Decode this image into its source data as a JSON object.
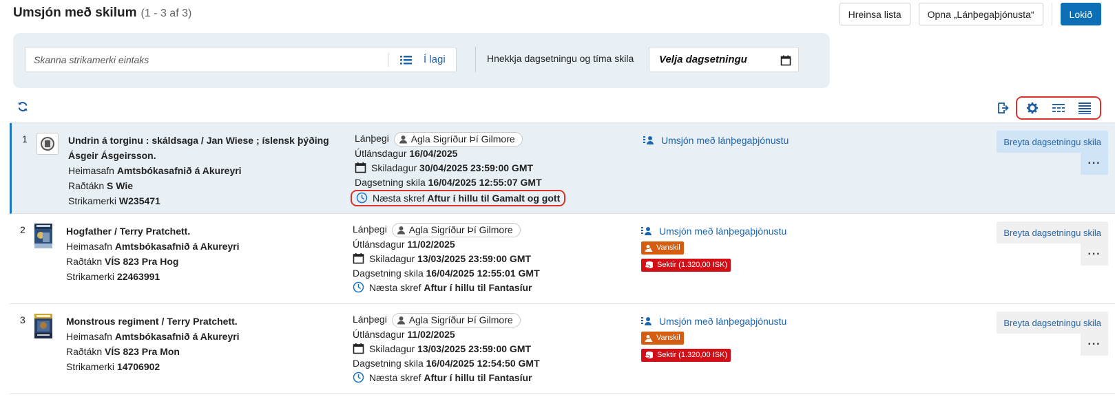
{
  "header": {
    "title": "Umsjón með skilum",
    "count": "(1 - 3 af 3)",
    "buttons": {
      "clear": "Hreinsa lista",
      "open_services": "Opna „Lánþegaþjónusta“",
      "done": "Lokið"
    }
  },
  "scan": {
    "placeholder": "Skanna strikamerki eintaks",
    "ok_label": "Í lagi",
    "date_label": "Hnekkja dagsetningu og tíma skila",
    "date_placeholder": "Velja dagsetningu"
  },
  "icons": {
    "refresh": "refresh-icon",
    "export": "export-icon",
    "settings": "gear-icon",
    "compact_view": "list-compact-icon",
    "full_view": "list-full-icon"
  },
  "colors": {
    "accent": "#0c6fb6",
    "link": "#1a64b0",
    "late_badge": "#d45d0f",
    "fine_badge": "#d20f16",
    "highlight": "#d9342b"
  },
  "rows": [
    {
      "num": "1",
      "title": "Undrin á torginu : skáldsaga / Jan Wiese ; íslensk þýðing Ásgeir Ásgeirsson.",
      "home_label": "Heimasafn",
      "home": "Amtsbókasafnið á Akureyri",
      "call_label": "Raðtákn",
      "call": "S Wie",
      "barcode_label": "Strikamerki",
      "barcode": "W235471",
      "patron_label": "Lánþegi",
      "patron": "Agla Sigríður Þí Gilmore",
      "loan_label": "Útlánsdagur",
      "loan_date": "16/04/2025",
      "due_label": "Skiladagur",
      "due_date": "30/04/2025 23:59:00 GMT",
      "return_label": "Dagsetning skila",
      "return_date": "16/04/2025 12:55:07 GMT",
      "next_label": "Næsta skref",
      "next_step": "Aftur í hillu til Gamalt og gott",
      "service_link": "Umsjón með lánþegaþjónustu",
      "late": "",
      "fine": "",
      "change_label": "Breyta dagsetningu skila",
      "more": "···"
    },
    {
      "num": "2",
      "title": "Hogfather / Terry Pratchett.",
      "home_label": "Heimasafn",
      "home": "Amtsbókasafnið á Akureyri",
      "call_label": "Raðtákn",
      "call": "VÍS 823 Pra Hog",
      "barcode_label": "Strikamerki",
      "barcode": "22463991",
      "patron_label": "Lánþegi",
      "patron": "Agla Sigríður Þí Gilmore",
      "loan_label": "Útlánsdagur",
      "loan_date": "11/02/2025",
      "due_label": "Skiladagur",
      "due_date": "13/03/2025 23:59:00 GMT",
      "return_label": "Dagsetning skila",
      "return_date": "16/04/2025 12:55:01 GMT",
      "next_label": "Næsta skref",
      "next_step": "Aftur í hillu til Fantasíur",
      "service_link": "Umsjón með lánþegaþjónustu",
      "late": "Vanskil",
      "fine": "Sektir (1.320,00 ISK)",
      "change_label": "Breyta dagsetningu skila",
      "more": "···"
    },
    {
      "num": "3",
      "title": "Monstrous regiment / Terry Pratchett.",
      "home_label": "Heimasafn",
      "home": "Amtsbókasafnið á Akureyri",
      "call_label": "Raðtákn",
      "call": "VÍS 823 Pra Mon",
      "barcode_label": "Strikamerki",
      "barcode": "14706902",
      "patron_label": "Lánþegi",
      "patron": "Agla Sigríður Þí Gilmore",
      "loan_label": "Útlánsdagur",
      "loan_date": "11/02/2025",
      "due_label": "Skiladagur",
      "due_date": "13/03/2025 23:59:00 GMT",
      "return_label": "Dagsetning skila",
      "return_date": "16/04/2025 12:54:50 GMT",
      "next_label": "Næsta skref",
      "next_step": "Aftur í hillu til Fantasíur",
      "service_link": "Umsjón með lánþegaþjónustu",
      "late": "Vanskil",
      "fine": "Sektir (1.320,00 ISK)",
      "change_label": "Breyta dagsetningu skila",
      "more": "···"
    }
  ]
}
